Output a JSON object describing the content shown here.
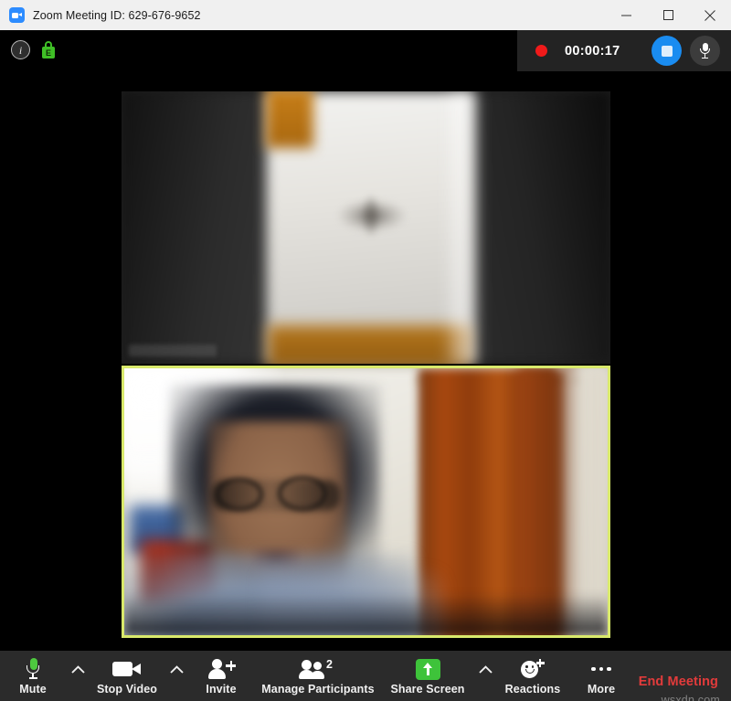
{
  "window": {
    "title": "Zoom Meeting ID: 629-676-9652",
    "app_icon": "zoom-camera-icon",
    "controls": {
      "minimize": "minimize-icon",
      "maximize": "maximize-icon",
      "close": "close-icon"
    }
  },
  "status_bar": {
    "info_icon_label": "i",
    "encryption_icon_label": "E",
    "recording": {
      "indicator": "record-dot",
      "elapsed": "00:00:17",
      "stop_button_icon": "stop-square-icon",
      "mic_button_icon": "microphone-icon"
    }
  },
  "stage": {
    "tiles": [
      {
        "name": "participant-video-top",
        "active_speaker": false,
        "name_label": ""
      },
      {
        "name": "participant-video-bottom",
        "active_speaker": true,
        "name_label": ""
      }
    ]
  },
  "toolbar": {
    "items": [
      {
        "label": "Mute",
        "icon": "microphone-icon",
        "has_caret": true
      },
      {
        "label": "Stop Video",
        "icon": "video-camera-icon",
        "has_caret": true
      },
      {
        "label": "Invite",
        "icon": "person-add-icon",
        "has_caret": false
      },
      {
        "label": "Manage Participants",
        "icon": "people-icon",
        "badge": "2",
        "has_caret": false
      },
      {
        "label": "Share Screen",
        "icon": "share-screen-up-arrow-icon",
        "has_caret": true
      },
      {
        "label": "Reactions",
        "icon": "smiley-add-icon",
        "has_caret": false
      },
      {
        "label": "More",
        "icon": "ellipsis-icon",
        "has_caret": false
      }
    ],
    "end_meeting": "End Meeting"
  },
  "watermark": "wsxdn.com",
  "colors": {
    "accent_blue": "#2d8cff",
    "record_red": "#f01a1a",
    "end_red": "#e23b3b",
    "green": "#3ec33a",
    "active_border": "#d9e96c",
    "toolbar_bg": "#2b2b2b"
  }
}
